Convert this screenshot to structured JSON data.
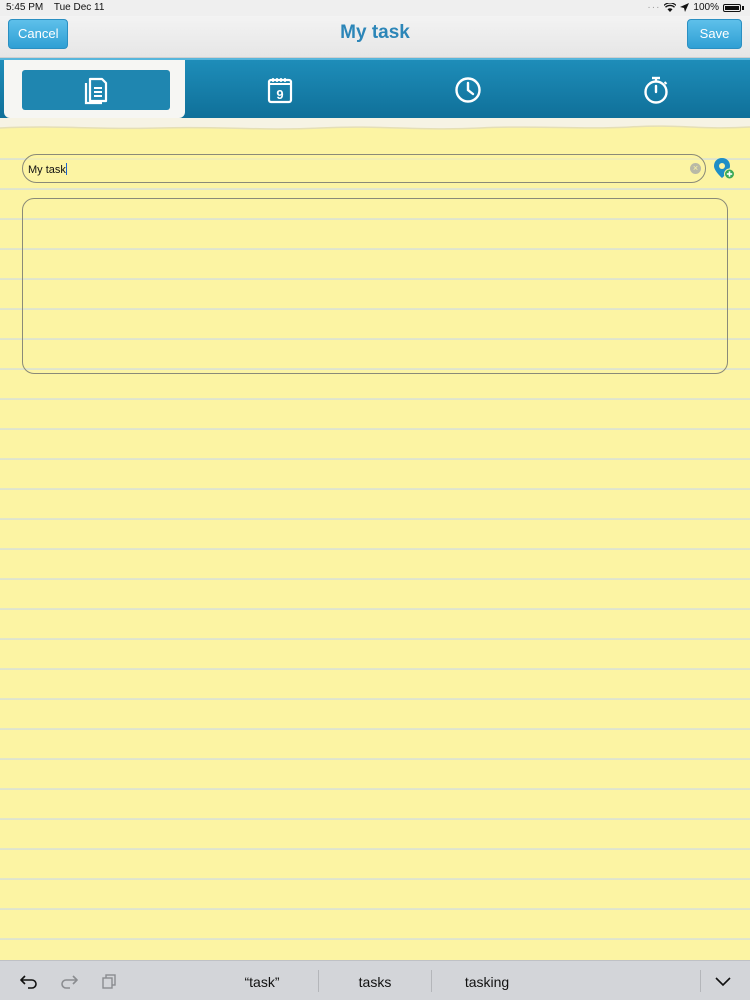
{
  "status_bar": {
    "time": "5:45 PM",
    "date": "Tue Dec 11",
    "battery": "100%"
  },
  "nav": {
    "cancel_label": "Cancel",
    "title": "My task",
    "save_label": "Save"
  },
  "tabs": [
    {
      "icon": "note-icon",
      "active": true
    },
    {
      "icon": "calendar-icon",
      "active": false,
      "day": "9"
    },
    {
      "icon": "clock-icon",
      "active": false
    },
    {
      "icon": "stopwatch-icon",
      "active": false
    }
  ],
  "form": {
    "title_value": "My task",
    "notes_value": ""
  },
  "keyboard_bar": {
    "suggestions": [
      "“task”",
      "tasks",
      "tasking"
    ]
  },
  "colors": {
    "accent": "#2f9fd4",
    "tab_bar": "#1679a4",
    "paper": "#fcf4a3"
  }
}
